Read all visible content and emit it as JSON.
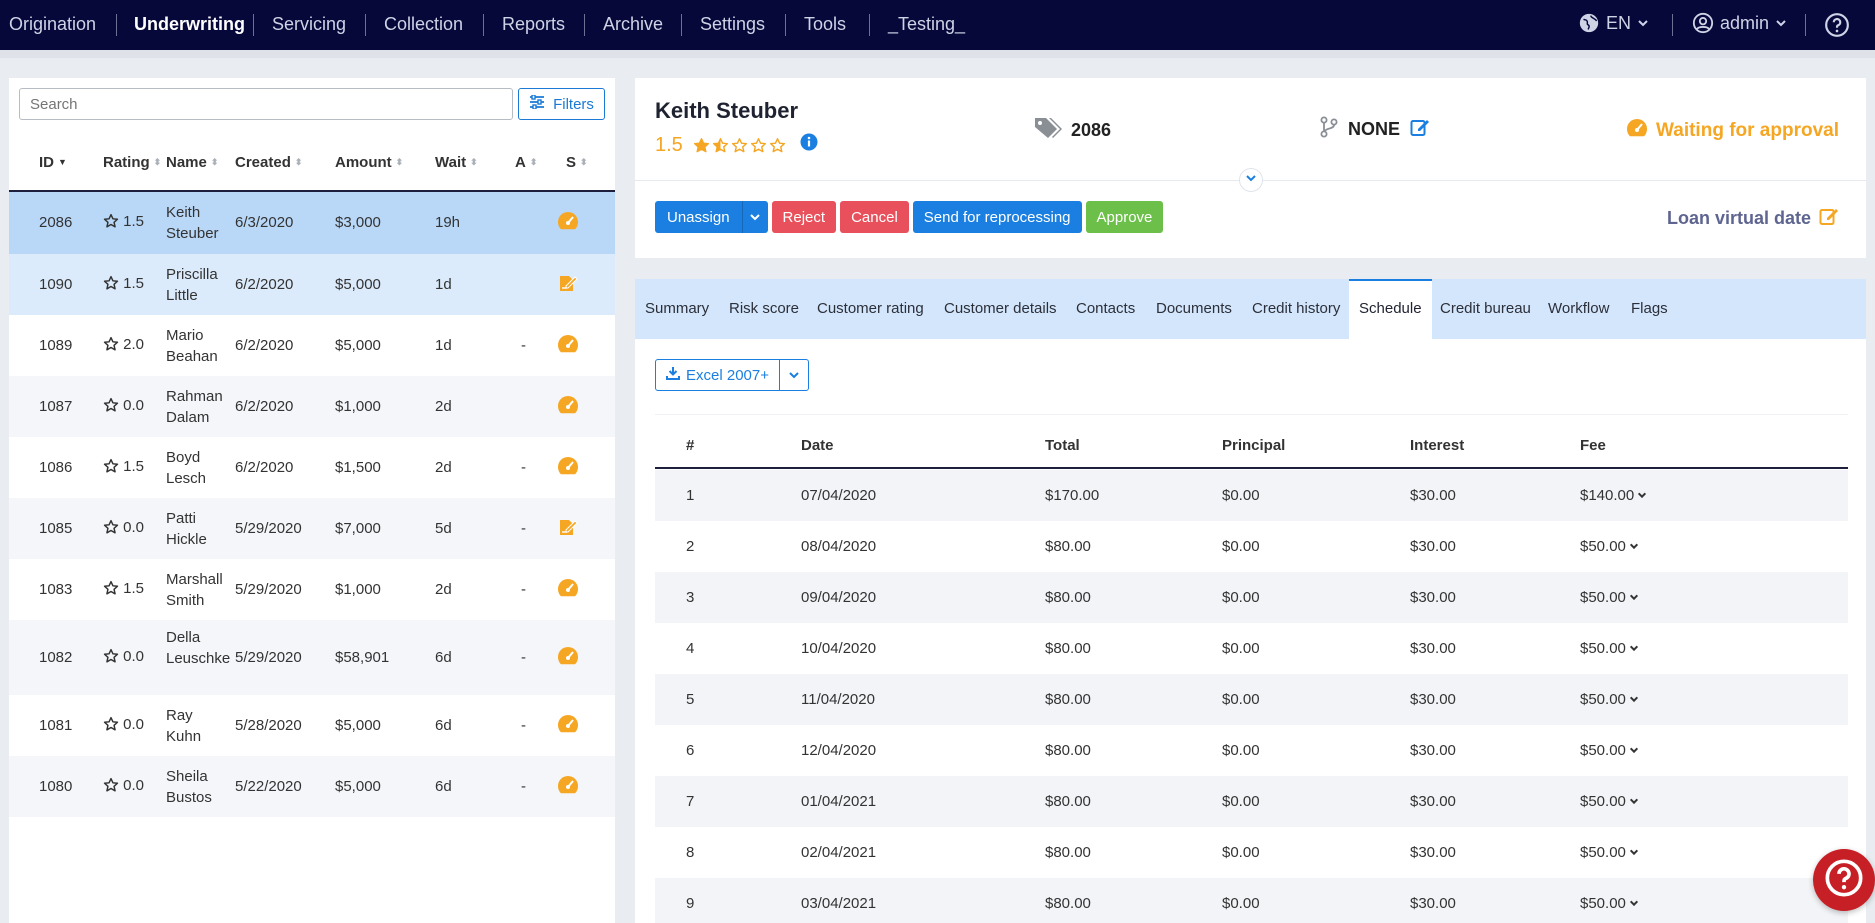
{
  "nav": {
    "items": [
      "Origination",
      "Underwriting",
      "Servicing",
      "Collection",
      "Reports",
      "Archive",
      "Settings",
      "Tools",
      "_Testing_"
    ],
    "active": "Underwriting",
    "language": "EN",
    "user": "admin"
  },
  "left": {
    "search_placeholder": "Search",
    "filters_label": "Filters",
    "columns": [
      "ID",
      "Rating",
      "Name",
      "Created",
      "Amount",
      "Wait",
      "A",
      "S"
    ],
    "rows": [
      {
        "id": "2086",
        "rating": "1.5",
        "name": "Keith Steuber",
        "created": "6/3/2020",
        "amount": "$3,000",
        "wait": "19h",
        "a": "",
        "s": "gauge"
      },
      {
        "id": "1090",
        "rating": "1.5",
        "name": "Priscilla Little",
        "created": "6/2/2020",
        "amount": "$5,000",
        "wait": "1d",
        "a": "",
        "s": "edit"
      },
      {
        "id": "1089",
        "rating": "2.0",
        "name": "Mario Beahan",
        "created": "6/2/2020",
        "amount": "$5,000",
        "wait": "1d",
        "a": "-",
        "s": "gauge"
      },
      {
        "id": "1087",
        "rating": "0.0",
        "name": "Rahman Dalam",
        "created": "6/2/2020",
        "amount": "$1,000",
        "wait": "2d",
        "a": "",
        "s": "gauge"
      },
      {
        "id": "1086",
        "rating": "1.5",
        "name": "Boyd Lesch",
        "created": "6/2/2020",
        "amount": "$1,500",
        "wait": "2d",
        "a": "-",
        "s": "gauge"
      },
      {
        "id": "1085",
        "rating": "0.0",
        "name": "Patti Hickle",
        "created": "5/29/2020",
        "amount": "$7,000",
        "wait": "5d",
        "a": "-",
        "s": "edit"
      },
      {
        "id": "1083",
        "rating": "1.5",
        "name": "Marshall Smith",
        "created": "5/29/2020",
        "amount": "$1,000",
        "wait": "2d",
        "a": "-",
        "s": "gauge"
      },
      {
        "id": "1082",
        "rating": "0.0",
        "name": "Della Leuschke",
        "created": "5/29/2020",
        "amount": "$58,901",
        "wait": "6d",
        "a": "-",
        "s": "gauge"
      },
      {
        "id": "1081",
        "rating": "0.0",
        "name": "Ray Kuhn",
        "created": "5/28/2020",
        "amount": "$5,000",
        "wait": "6d",
        "a": "-",
        "s": "gauge"
      },
      {
        "id": "1080",
        "rating": "0.0",
        "name": "Sheila Bustos",
        "created": "5/22/2020",
        "amount": "$5,000",
        "wait": "6d",
        "a": "-",
        "s": "gauge"
      }
    ]
  },
  "detail": {
    "customer_name": "Keith Steuber",
    "rating": "1.5",
    "rating_stars": 1.5,
    "loan_id": "2086",
    "workflow": "NONE",
    "status": "Waiting for approval",
    "buttons": {
      "unassign": "Unassign",
      "reject": "Reject",
      "cancel": "Cancel",
      "reprocess": "Send for reprocessing",
      "approve": "Approve"
    },
    "loan_virtual_date": "Loan virtual date"
  },
  "tabs": [
    "Summary",
    "Risk score",
    "Customer rating",
    "Customer details",
    "Contacts",
    "Documents",
    "Credit history",
    "Schedule",
    "Credit bureau",
    "Workflow",
    "Flags"
  ],
  "active_tab": "Schedule",
  "schedule": {
    "export_label": "Excel 2007+",
    "columns": [
      "#",
      "Date",
      "Total",
      "Principal",
      "Interest",
      "Fee"
    ],
    "rows": [
      {
        "n": "1",
        "date": "07/04/2020",
        "total": "$170.00",
        "principal": "$0.00",
        "interest": "$30.00",
        "fee": "$140.00"
      },
      {
        "n": "2",
        "date": "08/04/2020",
        "total": "$80.00",
        "principal": "$0.00",
        "interest": "$30.00",
        "fee": "$50.00"
      },
      {
        "n": "3",
        "date": "09/04/2020",
        "total": "$80.00",
        "principal": "$0.00",
        "interest": "$30.00",
        "fee": "$50.00"
      },
      {
        "n": "4",
        "date": "10/04/2020",
        "total": "$80.00",
        "principal": "$0.00",
        "interest": "$30.00",
        "fee": "$50.00"
      },
      {
        "n": "5",
        "date": "11/04/2020",
        "total": "$80.00",
        "principal": "$0.00",
        "interest": "$30.00",
        "fee": "$50.00"
      },
      {
        "n": "6",
        "date": "12/04/2020",
        "total": "$80.00",
        "principal": "$0.00",
        "interest": "$30.00",
        "fee": "$50.00"
      },
      {
        "n": "7",
        "date": "01/04/2021",
        "total": "$80.00",
        "principal": "$0.00",
        "interest": "$30.00",
        "fee": "$50.00"
      },
      {
        "n": "8",
        "date": "02/04/2021",
        "total": "$80.00",
        "principal": "$0.00",
        "interest": "$30.00",
        "fee": "$50.00"
      },
      {
        "n": "9",
        "date": "03/04/2021",
        "total": "$80.00",
        "principal": "$0.00",
        "interest": "$30.00",
        "fee": "$50.00"
      }
    ]
  },
  "colors": {
    "nav_bg": "#06083a",
    "accent_blue": "#1a7fe0",
    "status_orange": "#f5a623",
    "danger_red": "#e8505b",
    "success_green": "#6cc04a",
    "selected_row": "#b9d8f8",
    "hover_row": "#dcebfb",
    "tab_bar": "#d4e6fb"
  }
}
